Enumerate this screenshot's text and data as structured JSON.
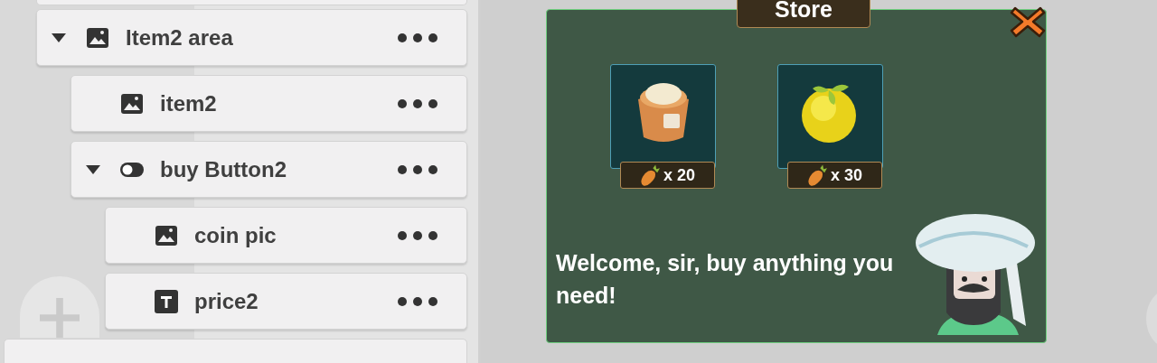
{
  "tree": [
    {
      "label": "Item2 area",
      "kind": "image",
      "expanded": true,
      "depth_children": [
        {
          "label": "item2",
          "kind": "image"
        },
        {
          "label": "buy Button2",
          "kind": "toggle",
          "expanded": true,
          "children": [
            {
              "label": "coin pic",
              "kind": "image"
            },
            {
              "label": "price2",
              "kind": "text"
            }
          ]
        }
      ]
    }
  ],
  "store": {
    "title": "Store",
    "items": [
      {
        "kind": "sack",
        "price": "x 20"
      },
      {
        "kind": "fruit",
        "price": "x 30"
      }
    ],
    "message": "Welcome, sir, buy anything you need!"
  }
}
